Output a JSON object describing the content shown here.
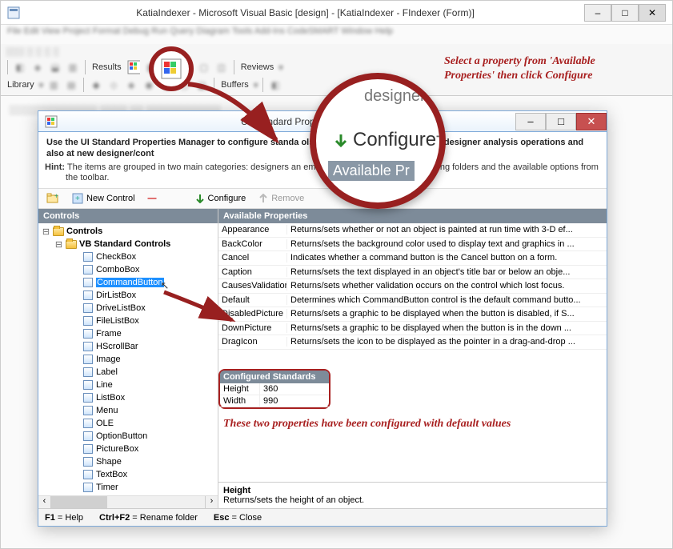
{
  "main": {
    "title": "KatiaIndexer - Microsoft Visual Basic [design] - [KatiaIndexer - FIndexer (Form)]"
  },
  "toolbar": {
    "results": "Results",
    "reviews": "Reviews",
    "library": "Library",
    "buffers": "Buffers"
  },
  "annotations": {
    "top": "Select a property from 'Available Properties' then click Configure",
    "conf": "These two properties have been configured with default values"
  },
  "magnifier": {
    "designers": "designers",
    "configure": "Configure",
    "available": "Available Pr",
    "t_suffix": "T"
  },
  "dialog": {
    "title": "UI Standard Properties",
    "instruction_bold": "Use the UI Standard Properties Manager to configure standa                                       ols. The standards will be used in designer analysis operations and also at new designer/cont",
    "hint_label": "Hint:",
    "hint_text": " The items are grouped in two main categories: designers an                                                 emove and manage controls by using folders and the available options from the toolbar.",
    "toolbar": {
      "new_control": "New Control",
      "configure": "Configure",
      "remove": "Remove"
    },
    "left_header": "Controls",
    "right_header": "Available Properties",
    "conf_header": "Configured Standards",
    "tree": {
      "root": "Controls",
      "folder": "VB Standard Controls",
      "items": [
        "CheckBox",
        "ComboBox",
        "CommandButton",
        "DirListBox",
        "DriveListBox",
        "FileListBox",
        "Frame",
        "HScrollBar",
        "Image",
        "Label",
        "Line",
        "ListBox",
        "Menu",
        "OLE",
        "OptionButton",
        "PictureBox",
        "Shape",
        "TextBox",
        "Timer"
      ]
    },
    "props": [
      {
        "n": "Appearance",
        "d": "Returns/sets whether or not an object is painted at run time with 3-D ef..."
      },
      {
        "n": "BackColor",
        "d": "Returns/sets the background color used to display text and graphics in ..."
      },
      {
        "n": "Cancel",
        "d": "Indicates whether a command button is the Cancel button on a form."
      },
      {
        "n": "Caption",
        "d": "Returns/sets the text displayed in an object's title bar or below an obje..."
      },
      {
        "n": "CausesValidation",
        "d": "Returns/sets whether validation occurs on the control which lost focus."
      },
      {
        "n": "Default",
        "d": "Determines which CommandButton control is the default command butto..."
      },
      {
        "n": "DisabledPicture",
        "d": "Returns/sets a graphic to be displayed when the button is disabled, if S..."
      },
      {
        "n": "DownPicture",
        "d": "Returns/sets a graphic to be displayed when the button is in the down ..."
      },
      {
        "n": "DragIcon",
        "d": "Returns/sets the icon to be displayed as the pointer in a drag-and-drop ..."
      }
    ],
    "configured": [
      {
        "name": "Height",
        "value": "360"
      },
      {
        "name": "Width",
        "value": "990"
      }
    ],
    "desc": {
      "name": "Height",
      "text": "Returns/sets the height of an object."
    },
    "status": {
      "f1": "F1",
      "f1l": " = Help",
      "cf2": "Ctrl+F2",
      "cf2l": " = Rename folder",
      "esc": "Esc",
      "escl": " = Close"
    }
  }
}
